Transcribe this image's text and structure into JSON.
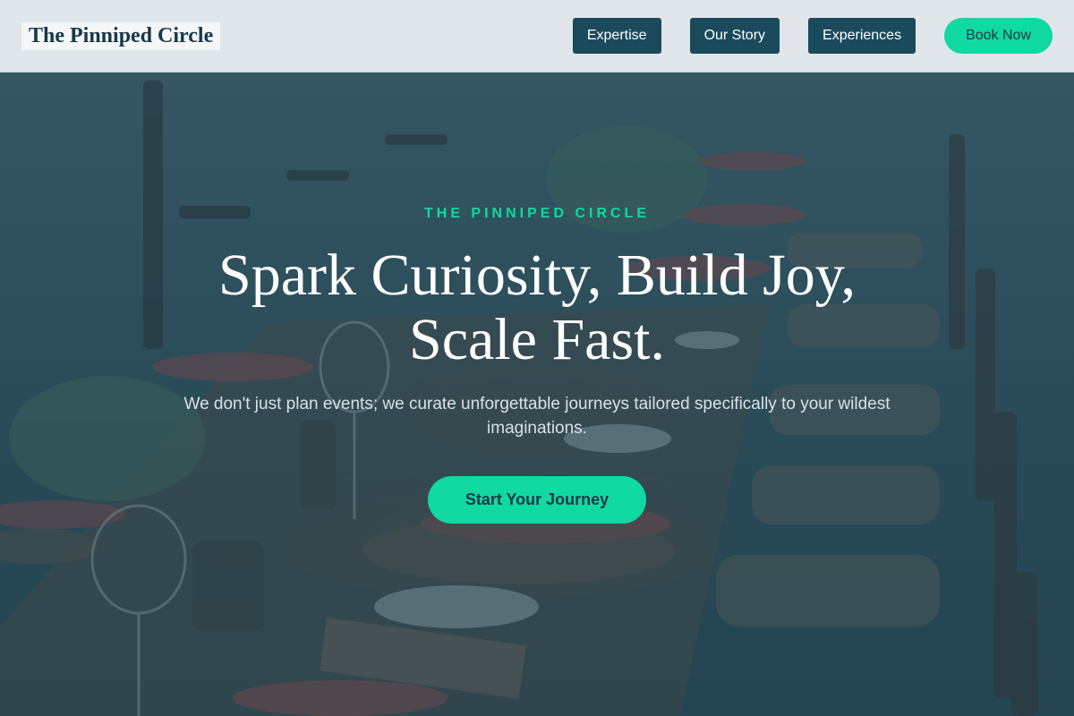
{
  "header": {
    "brand": "The Pinniped Circle",
    "nav": [
      {
        "label": "Expertise"
      },
      {
        "label": "Our Story"
      },
      {
        "label": "Experiences"
      }
    ],
    "book_label": "Book Now"
  },
  "hero": {
    "eyebrow": "THE PINNIPED CIRCLE",
    "headline": "Spark Curiosity, Build Joy, Scale Fast.",
    "subtext": "We don't just plan events; we curate unforgettable journeys tailored specifically to your wildest imaginations.",
    "cta_label": "Start Your Journey",
    "background_image": "outdoor dining table with chairs by the water"
  },
  "colors": {
    "accent": "#10d9a1",
    "nav_button": "#1b4a5c",
    "brand_text": "#17384a",
    "overlay": "#183a48"
  }
}
